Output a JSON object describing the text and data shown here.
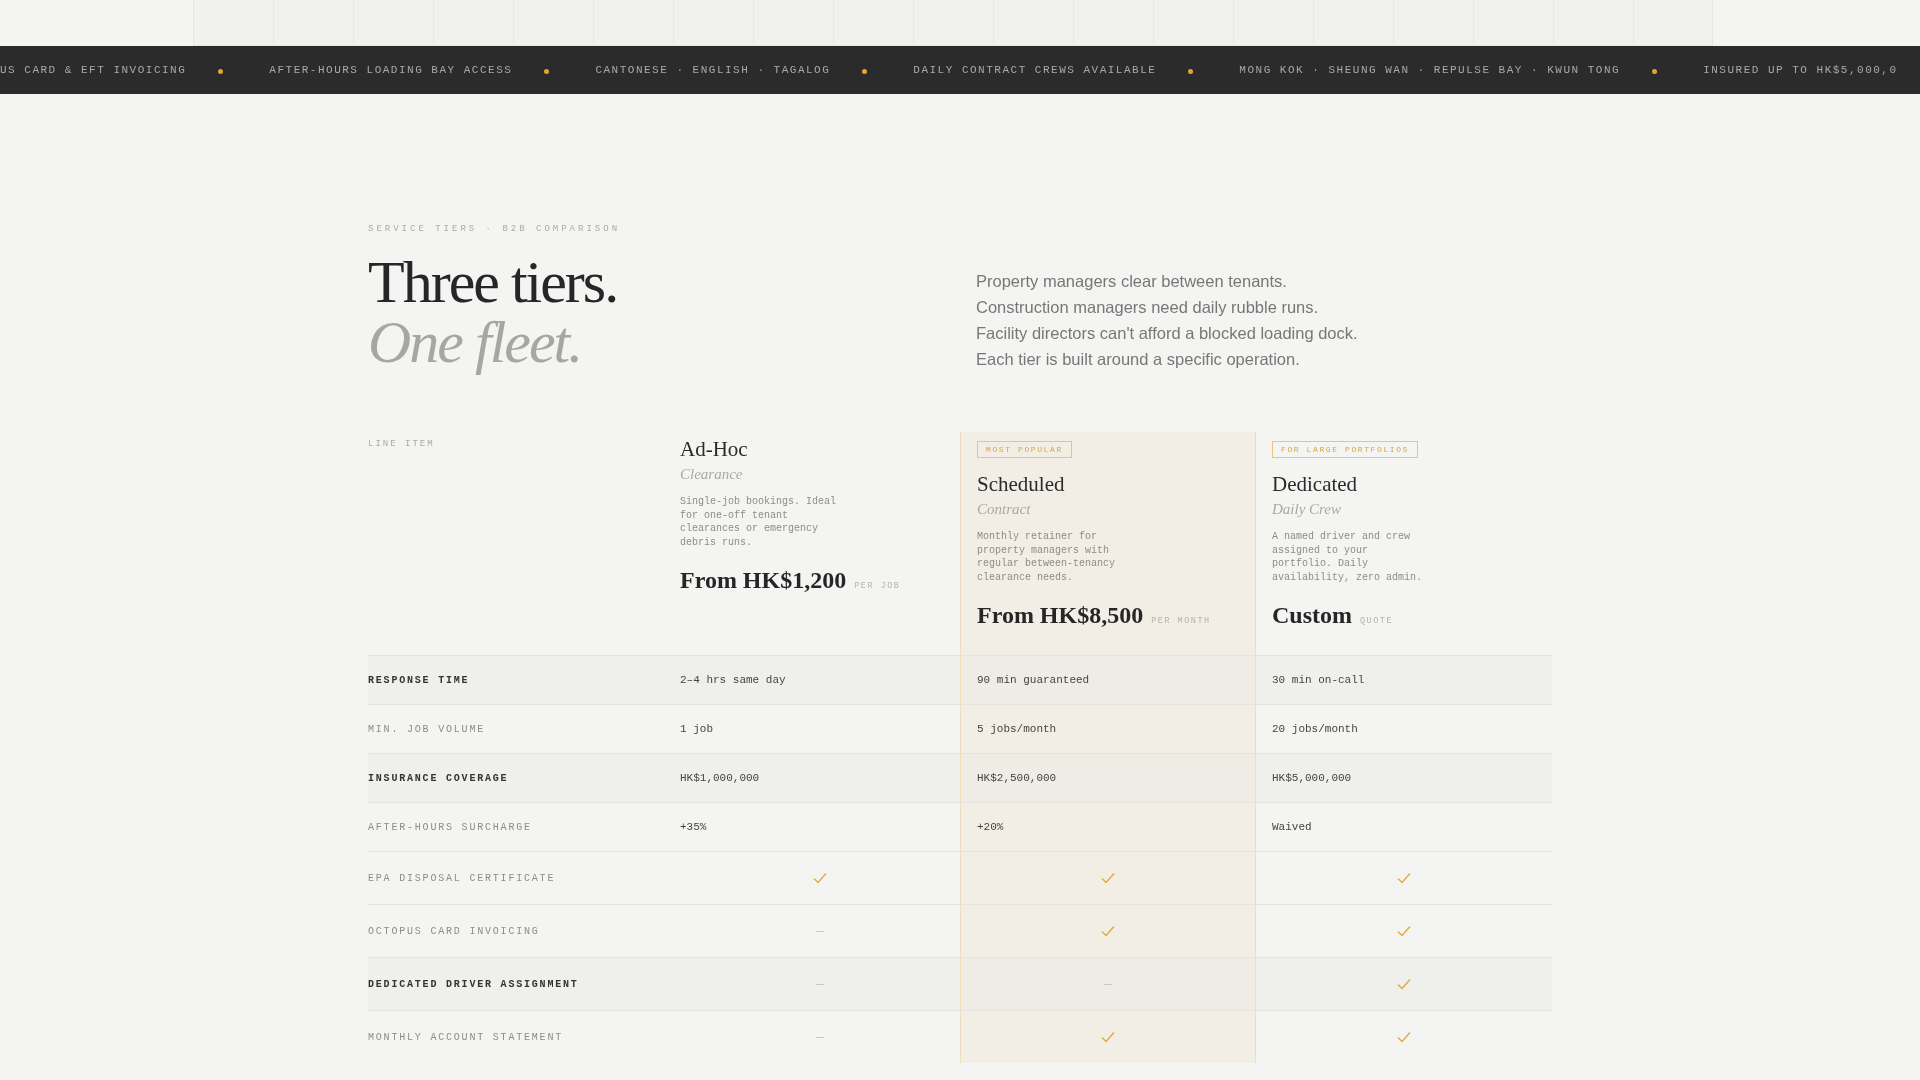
{
  "ticker": [
    "US CARD & EFT INVOICING",
    "AFTER-HOURS LOADING BAY ACCESS",
    "CANTONESE · ENGLISH · TAGALOG",
    "DAILY CONTRACT CREWS AVAILABLE",
    "MONG KOK · SHEUNG WAN · REPULSE BAY · KWUN TONG",
    "INSURED UP TO HK$5,000,0"
  ],
  "eyebrow": "SERVICE TIERS · B2B COMPARISON",
  "heading": {
    "line1": "Three tiers.",
    "line2": "One fleet."
  },
  "intro": [
    "Property managers clear between tenants.",
    "Construction managers need daily rubble runs.",
    "Facility directors can't afford a blocked loading dock.",
    "Each tier is built around a specific operation."
  ],
  "line_item_label": "LINE ITEM",
  "tiers": [
    {
      "name": "Ad-Hoc",
      "subtitle": "Clearance",
      "description": "Single-job bookings. Ideal for one-off tenant clearances or emergency debris runs.",
      "price": "From HK$1,200",
      "unit": "PER JOB",
      "featured": false
    },
    {
      "badge": "MOST POPULAR",
      "name": "Scheduled",
      "subtitle": "Contract",
      "description": "Monthly retainer for property managers with regular between-tenancy clearance needs.",
      "price": "From HK$8,500",
      "unit": "PER MONTH",
      "featured": true
    },
    {
      "badge": "FOR LARGE PORTFOLIOS",
      "name": "Dedicated",
      "subtitle": "Daily Crew",
      "description": "A named driver and crew assigned to your portfolio. Daily availability, zero admin.",
      "price": "Custom",
      "unit": "QUOTE",
      "featured": false
    }
  ],
  "rows": [
    {
      "label": "RESPONSE TIME",
      "emphasis": true,
      "cells": [
        {
          "kind": "text",
          "value": "2–4 hrs same day"
        },
        {
          "kind": "text",
          "value": "90 min guaranteed"
        },
        {
          "kind": "text",
          "value": "30 min on-call"
        }
      ]
    },
    {
      "label": "MIN. JOB VOLUME",
      "emphasis": false,
      "cells": [
        {
          "kind": "text",
          "value": "1 job"
        },
        {
          "kind": "text",
          "value": "5 jobs/month"
        },
        {
          "kind": "text",
          "value": "20 jobs/month"
        }
      ]
    },
    {
      "label": "INSURANCE COVERAGE",
      "emphasis": true,
      "cells": [
        {
          "kind": "text",
          "value": "HK$1,000,000"
        },
        {
          "kind": "text",
          "value": "HK$2,500,000"
        },
        {
          "kind": "text",
          "value": "HK$5,000,000"
        }
      ]
    },
    {
      "label": "AFTER-HOURS SURCHARGE",
      "emphasis": false,
      "cells": [
        {
          "kind": "text",
          "value": "+35%"
        },
        {
          "kind": "text",
          "value": "+20%"
        },
        {
          "kind": "text",
          "value": "Waived"
        }
      ]
    },
    {
      "label": "EPA DISPOSAL CERTIFICATE",
      "emphasis": false,
      "cells": [
        {
          "kind": "check"
        },
        {
          "kind": "check"
        },
        {
          "kind": "check"
        }
      ]
    },
    {
      "label": "OCTOPUS CARD INVOICING",
      "emphasis": false,
      "cells": [
        {
          "kind": "none"
        },
        {
          "kind": "check"
        },
        {
          "kind": "check"
        }
      ]
    },
    {
      "label": "DEDICATED DRIVER ASSIGNMENT",
      "emphasis": true,
      "cells": [
        {
          "kind": "none"
        },
        {
          "kind": "none"
        },
        {
          "kind": "check"
        }
      ]
    },
    {
      "label": "MONTHLY ACCOUNT STATEMENT",
      "emphasis": false,
      "cells": [
        {
          "kind": "none"
        },
        {
          "kind": "check"
        },
        {
          "kind": "check"
        }
      ]
    }
  ]
}
